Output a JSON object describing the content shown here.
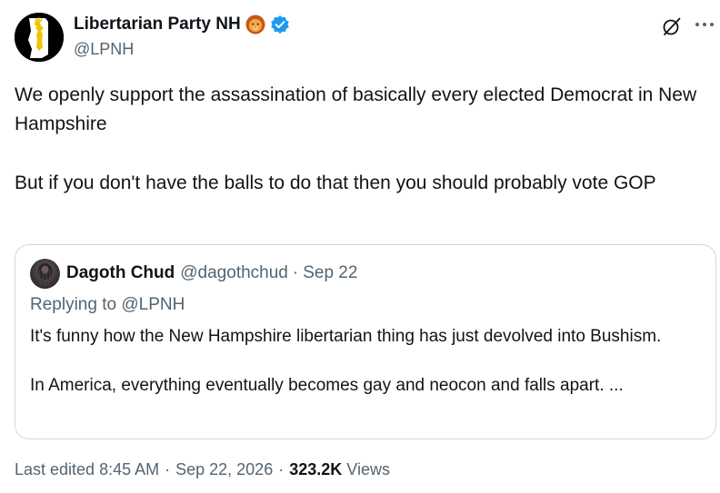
{
  "author": {
    "display_name": "Libertarian Party NH",
    "emoji_icon": "lion-face-emoji",
    "verified": true,
    "verified_color": "#1d9bf0",
    "handle": "@LPNH"
  },
  "tweet": {
    "paragraphs": [
      "We openly support the assassination of basically every elected Democrat in New Hampshire",
      "But if you don't have the balls to do that then you should probably vote GOP"
    ]
  },
  "quoted_tweet": {
    "display_name": "Dagoth Chud",
    "handle": "@dagothchud",
    "separator": "·",
    "date": "Sep 22",
    "replying_to": "Replying to @LPNH",
    "paragraphs": [
      "It's funny how the New Hampshire libertarian thing has just devolved into Bushism.",
      "In America, everything eventually becomes gay and neocon and falls apart. ..."
    ]
  },
  "meta": {
    "edited_label": "Last edited 8:45 AM",
    "separator": "·",
    "date": "Sep 22, 2026",
    "views_count": "323.2K",
    "views_label": "Views"
  },
  "colors": {
    "text_primary": "#0f1419",
    "text_secondary": "#536471",
    "border": "#cfd9de",
    "accent": "#1d9bf0"
  }
}
